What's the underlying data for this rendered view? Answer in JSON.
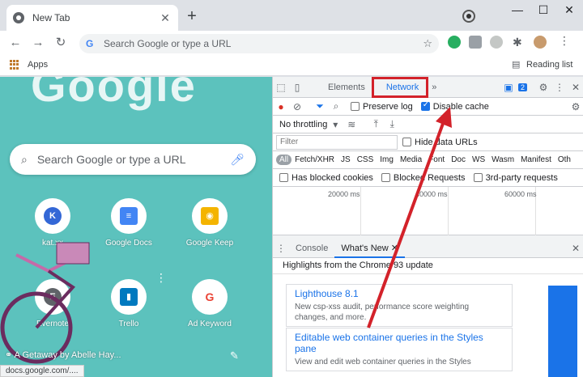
{
  "browser": {
    "tab_title": "New Tab",
    "tab_close": "✕",
    "new_tab": "+",
    "window_controls": [
      "—",
      "☐",
      "✕"
    ],
    "omnibox_placeholder": "Search Google or type a URL",
    "bookmarks_apps": "Apps",
    "reading_list": "Reading list"
  },
  "ntp": {
    "logo_text": "Google",
    "search_placeholder": "Search Google or type a URL",
    "shortcuts": [
      {
        "label": "kat.xx",
        "initial": "K",
        "color": "#3367d6"
      },
      {
        "label": "Google Docs",
        "initial": "≡",
        "color": "#4285f4"
      },
      {
        "label": "Google Keep",
        "initial": "◉",
        "color": "#f4b400"
      },
      {
        "label": "Evernote",
        "initial": "E",
        "color": "#5f6368"
      },
      {
        "label": "Trello",
        "initial": "▮",
        "color": "#0079bf"
      },
      {
        "label": "Ad Keyword",
        "initial": "G",
        "color": "#ea4335"
      }
    ],
    "footer_text": "A Getaway by Abelle Hay...",
    "status_url": "docs.google.com/...."
  },
  "devtools": {
    "tabs": [
      "Elements",
      "Network",
      "»"
    ],
    "active_tab": "Network",
    "issues_count": "2",
    "preserve_log": "Preserve log",
    "disable_cache": "Disable cache",
    "throttling": "No throttling",
    "filter_placeholder": "Filter",
    "hide_data_urls": "Hide data URLs",
    "filter_types": [
      "All",
      "Fetch/XHR",
      "JS",
      "CSS",
      "Img",
      "Media",
      "Font",
      "Doc",
      "WS",
      "Wasm",
      "Manifest",
      "Oth"
    ],
    "has_blocked_cookies": "Has blocked cookies",
    "blocked_requests": "Blocked Requests",
    "third_party": "3rd-party requests",
    "timeline_ticks": [
      "20000 ms",
      "40000 ms",
      "60000 ms"
    ],
    "drawer_tabs": [
      "Console",
      "What's New"
    ],
    "drawer_active": "What's New",
    "highlights": "Highlights from the Chrome 93 update",
    "cards": [
      {
        "title": "Lighthouse 8.1",
        "desc": "New csp-xss audit, performance score weighting changes, and more."
      },
      {
        "title": "Editable web container queries in the Styles pane",
        "desc": "View and edit web container queries in the Styles"
      }
    ]
  },
  "colors": {
    "highlight_red": "#d3222a",
    "ntp_teal": "#5cc2bd",
    "devtools_blue": "#1a73e8"
  }
}
